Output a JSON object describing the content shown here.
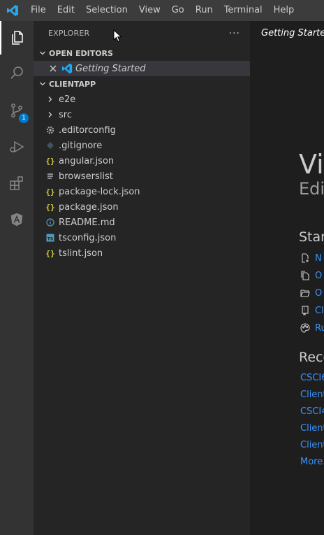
{
  "menu": {
    "items": [
      "File",
      "Edit",
      "Selection",
      "View",
      "Go",
      "Run",
      "Terminal",
      "Help"
    ]
  },
  "activity_bar": {
    "items": [
      {
        "icon": "files-icon",
        "active": true
      },
      {
        "icon": "search-icon"
      },
      {
        "icon": "source-control-icon",
        "badge": "1"
      },
      {
        "icon": "run-debug-icon"
      },
      {
        "icon": "extensions-icon"
      },
      {
        "icon": "angular-icon"
      }
    ]
  },
  "explorer": {
    "title": "EXPLORER",
    "more_label": "···",
    "open_editors": {
      "title": "OPEN EDITORS",
      "items": [
        {
          "label": "Getting Started",
          "icon": "vscode-icon"
        }
      ]
    },
    "project": {
      "title": "CLIENTAPP",
      "folders": [
        {
          "label": "e2e"
        },
        {
          "label": "src"
        }
      ],
      "files": [
        {
          "label": ".editorconfig",
          "icon": "gear-icon",
          "color": "#a6a6a6"
        },
        {
          "label": ".gitignore",
          "icon": "git-icon",
          "color": "#41535b"
        },
        {
          "label": "angular.json",
          "icon": "json-icon",
          "color": "#cbcb41"
        },
        {
          "label": "browserslist",
          "icon": "text-file-icon",
          "color": "#cccccc"
        },
        {
          "label": "package-lock.json",
          "icon": "json-icon",
          "color": "#cbcb41"
        },
        {
          "label": "package.json",
          "icon": "json-icon",
          "color": "#cbcb41"
        },
        {
          "label": "README.md",
          "icon": "info-icon",
          "color": "#519aba"
        },
        {
          "label": "tsconfig.json",
          "icon": "typescript-icon",
          "color": "#519aba"
        },
        {
          "label": "tslint.json",
          "icon": "json-icon",
          "color": "#cbcb41"
        }
      ]
    }
  },
  "editor": {
    "tab_label": "Getting Starte",
    "welcome": {
      "title": "Vis",
      "subtitle": "Edit",
      "start_title": "Start",
      "start_items": [
        {
          "label": "N",
          "icon": "new-file-icon"
        },
        {
          "label": "O",
          "icon": "open-file-icon"
        },
        {
          "label": "O",
          "icon": "open-folder-icon"
        },
        {
          "label": "Cl",
          "icon": "clone-repo-icon"
        },
        {
          "label": "Ru",
          "icon": "palette-icon"
        }
      ],
      "recent_title": "Rece",
      "recent_items": [
        "CSCI6",
        "Client",
        "CSCI4",
        "Client",
        "Client",
        "More..."
      ]
    }
  },
  "colors": {
    "accent": "#007acc",
    "link": "#3794ff",
    "json": "#cbcb41"
  }
}
